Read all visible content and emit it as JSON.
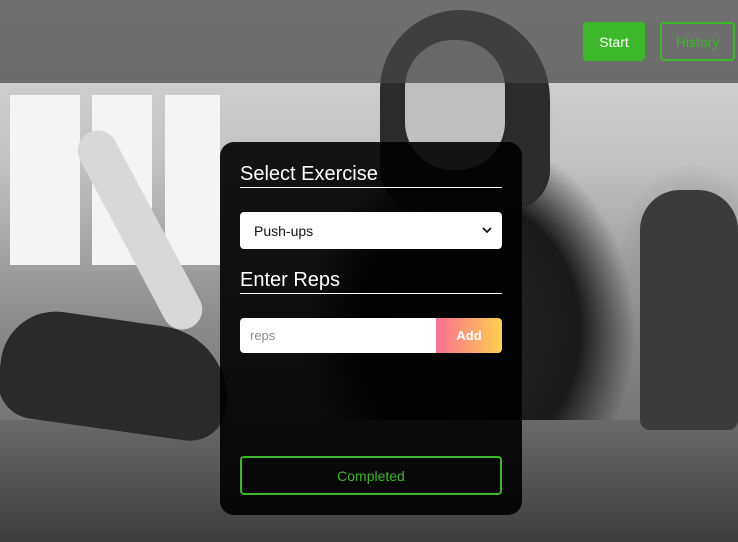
{
  "header": {
    "start_label": "Start",
    "history_label": "History"
  },
  "card": {
    "select_heading": "Select Exercise",
    "exercise_select": {
      "selected": "Push-ups",
      "icon": "chevron-down-icon"
    },
    "reps_heading": "Enter Reps",
    "reps_input": {
      "value": "",
      "placeholder": "reps"
    },
    "add_label": "Add",
    "completed_label": "Completed"
  },
  "colors": {
    "accent_green": "#3db82a",
    "add_gradient_start": "#fb6f92",
    "add_gradient_end": "#fcd34d",
    "card_bg": "#000000"
  }
}
